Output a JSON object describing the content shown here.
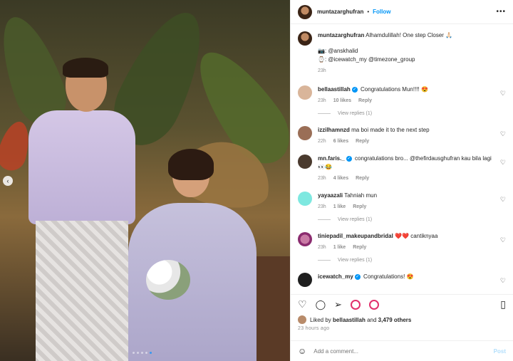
{
  "header": {
    "username": "muntazarghufran",
    "separator": "•",
    "follow_label": "Follow",
    "more_icon": "more-horizontal-icon"
  },
  "caption": {
    "username": "muntazarghufran",
    "text": "Alhamdulillah! One step Closer",
    "line1": "📷: @anskhalid",
    "line2": "⌚: @icewatch_my @timezone_group",
    "time": "23h"
  },
  "comments": [
    {
      "username": "bellaastillah",
      "verified": true,
      "text": "Congratulations Mun!!!! 😍",
      "time": "23h",
      "likes": "10 likes",
      "reply": "Reply",
      "view_replies": "View replies (1)"
    },
    {
      "username": "izzilhamnzd",
      "verified": false,
      "text": "ma boi made it to the next step",
      "time": "22h",
      "likes": "6 likes",
      "reply": "Reply",
      "view_replies": ""
    },
    {
      "username": "mn.faris._",
      "verified": true,
      "text": "congratulations bro... @thefirdausghufran kau bila lagi👀😂",
      "time": "23h",
      "likes": "4 likes",
      "reply": "Reply",
      "view_replies": ""
    },
    {
      "username": "yayaazali",
      "verified": false,
      "text": "Tahniah mun",
      "time": "23h",
      "likes": "1 like",
      "reply": "Reply",
      "view_replies": "View replies (1)"
    },
    {
      "username": "tiniepadil_makeupandbridal",
      "verified": false,
      "text": "❤️❤️ cantiknyaa",
      "time": "23h",
      "likes": "1 like",
      "reply": "Reply",
      "view_replies": "View replies (1)"
    },
    {
      "username": "icewatch_my",
      "verified": true,
      "text": "Congratulations! 😍",
      "time": "",
      "likes": "",
      "reply": "",
      "view_replies": ""
    }
  ],
  "likes": {
    "prefix": "Liked by",
    "user": "bellaastillah",
    "and": "and",
    "others": "3,479 others"
  },
  "timestamp": "23 hours ago",
  "add_comment": {
    "placeholder": "Add a comment...",
    "post_label": "Post"
  },
  "colors": {
    "accent": "#0095f6",
    "muted": "#8e8e8e",
    "text": "#262626"
  }
}
